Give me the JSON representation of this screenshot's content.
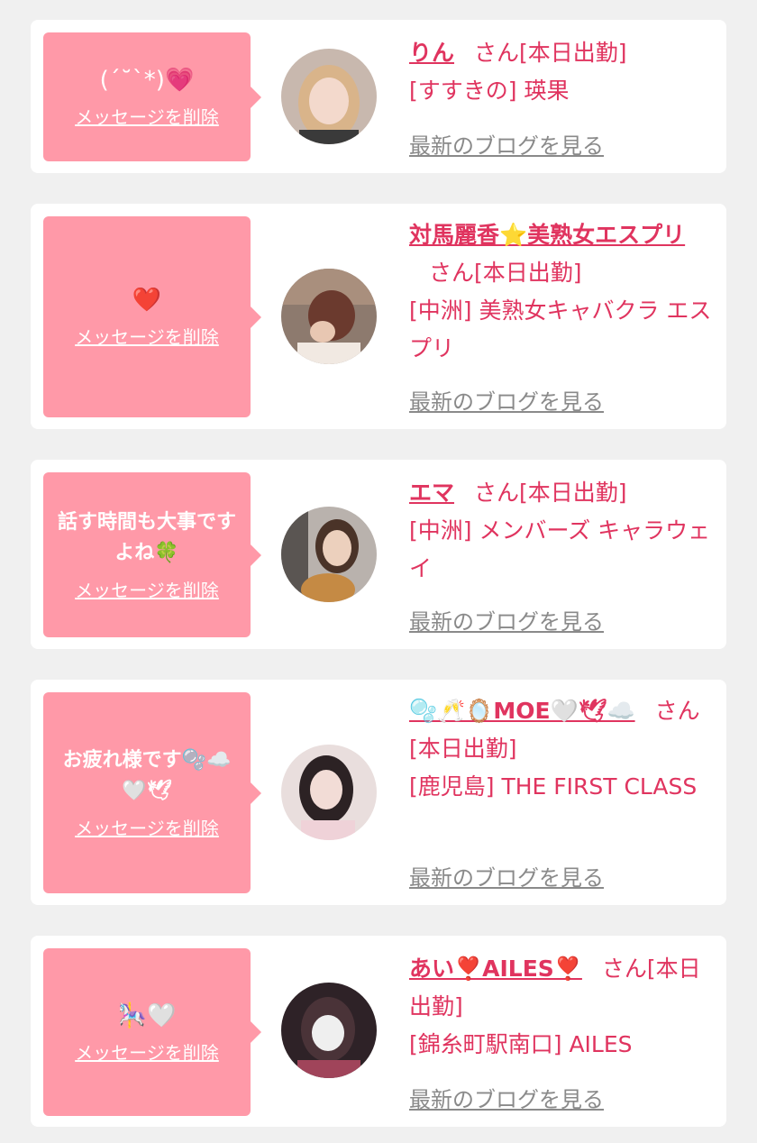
{
  "delete_label": "メッセージを削除",
  "blog_label": "最新のブログを見る",
  "colors": {
    "accent": "#e0345f",
    "bubble": "#ff99a8",
    "link_gray": "#8a8a8a",
    "background": "#f0f0f0"
  },
  "cards": [
    {
      "message": "(ˊ˘ˋ*)💗",
      "name": "りん",
      "suffix": "さん[本日出勤]",
      "shop": "[すすきの] 瑛果"
    },
    {
      "message": "❤️",
      "name": "対馬麗香⭐美熟女エスプリ",
      "suffix": "さん[本日出勤]",
      "shop": "[中洲] 美熟女キャバクラ エスプリ"
    },
    {
      "message": "話す時間も大事ですよね🍀",
      "name": "エマ",
      "suffix": "さん[本日出勤]",
      "shop": "[中洲] メンバーズ キャラウェイ"
    },
    {
      "message": "お疲れ様です🫧☁️🤍🕊",
      "name": "🫧🥂🪞MOE🤍🕊☁️",
      "suffix": "さん[本日出勤]",
      "shop": "[鹿児島] THE FIRST CLASS"
    },
    {
      "message": "🎠🤍",
      "name": "あい❣️AILES❣️",
      "suffix": "さん[本日出勤]",
      "shop": "[錦糸町駅南口] AILES"
    }
  ]
}
